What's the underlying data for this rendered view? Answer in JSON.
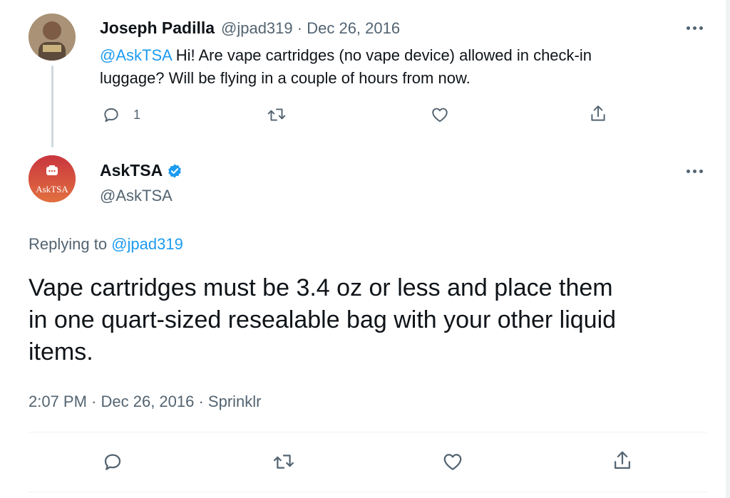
{
  "tweet1": {
    "author_name": "Joseph Padilla",
    "author_handle": "@jpad319",
    "separator": "·",
    "date": "Dec 26, 2016",
    "mention": "@AskTSA",
    "text_line1": " Hi! Are vape cartridges (no vape device) allowed in check-in",
    "text_line2": "luggage? Will be flying in a couple of hours from now.",
    "reply_count": "1"
  },
  "tweet2": {
    "author_name": "AskTSA",
    "author_handle": "@AskTSA",
    "avatar_text": "AskTSA",
    "replying_to_label": "Replying to ",
    "replying_to_handle": "@jpad319",
    "text_line1": "Vape cartridges must be 3.4 oz or less and place them",
    "text_line2": "in one quart-sized resealable bag with your other liquid",
    "text_line3": "items.",
    "meta": "2:07 PM · Dec 26, 2016 · Sprinklr"
  },
  "icons": [
    "reply-icon",
    "retweet-icon",
    "like-icon",
    "share-icon",
    "more-icon",
    "verified-badge-icon"
  ],
  "colors": {
    "link": "#1d9bf0",
    "muted": "#536471",
    "text": "#0f1419",
    "avatar_tsa": "#d6503f"
  }
}
